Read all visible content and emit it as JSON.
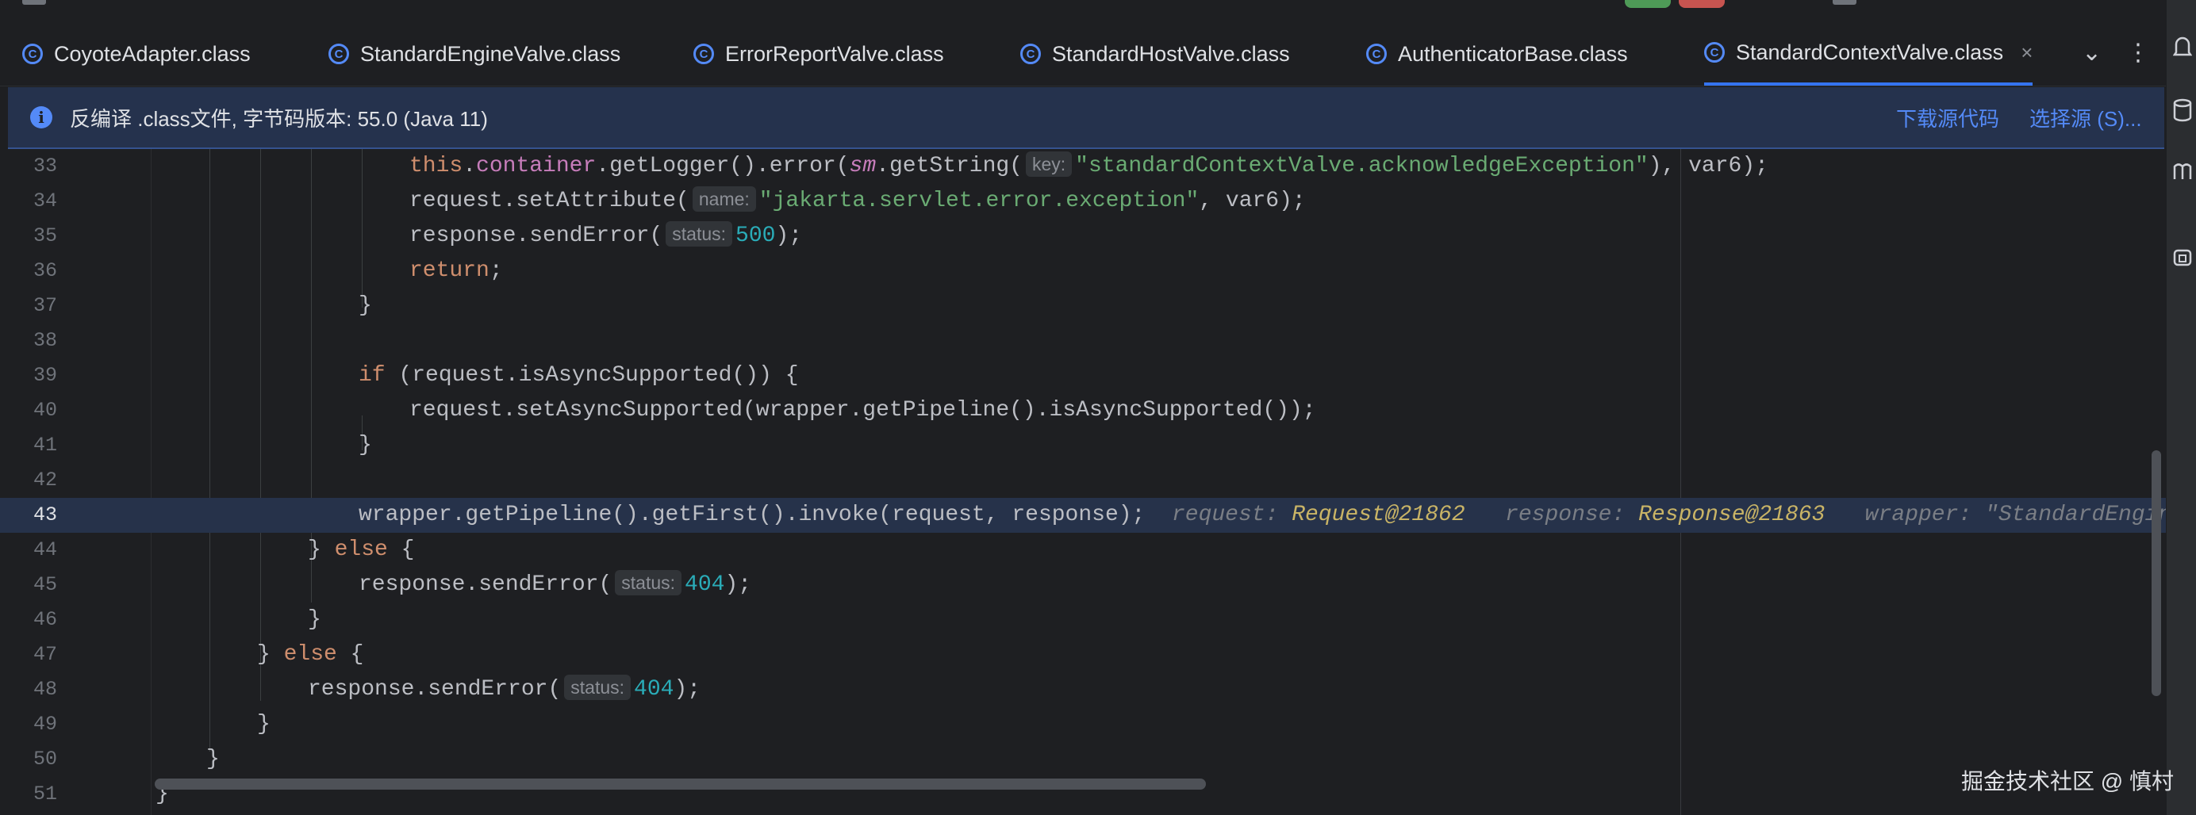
{
  "tabs": [
    {
      "label": "CoyoteAdapter.class",
      "active": false
    },
    {
      "label": "StandardEngineValve.class",
      "active": false
    },
    {
      "label": "ErrorReportValve.class",
      "active": false
    },
    {
      "label": "StandardHostValve.class",
      "active": false
    },
    {
      "label": "AuthenticatorBase.class",
      "active": false
    },
    {
      "label": "StandardContextValve.class",
      "active": true
    }
  ],
  "tab_icon_letter": "C",
  "tab_close_glyph": "×",
  "tab_actions": {
    "dropdown_glyph": "⌄",
    "more_glyph": "⋮"
  },
  "banner": {
    "icon_glyph": "i",
    "text": "反编译 .class文件, 字节码版本: 55.0 (Java 11)",
    "download_link": "下载源代码",
    "choose_link": "选择源 (S)..."
  },
  "hints": {
    "key": "key:",
    "name": "name:",
    "status": "status:"
  },
  "strings": {
    "ack_key": "\"standardContextValve.acknowledgeException\"",
    "servlet_attr": "\"jakarta.servlet.error.exception\""
  },
  "numbers": {
    "status_500": "500",
    "status_404": "404"
  },
  "debug": {
    "request_label": "request:",
    "request_value": "Request@21862",
    "response_label": "response:",
    "response_value": "Response@21863",
    "wrapper_label": "wrapper:",
    "wrapper_value": "\"StandardEngine[To"
  },
  "line_numbers": [
    "33",
    "34",
    "35",
    "36",
    "37",
    "38",
    "39",
    "40",
    "41",
    "42",
    "43",
    "44",
    "45",
    "46",
    "47",
    "48",
    "49",
    "50",
    "51"
  ],
  "current_line": "43",
  "right_strip_icons": [
    "notification-bell-icon",
    "database-icon",
    "m-icon",
    "copilot-icon"
  ],
  "watermark": "掘金技术社区 @ 慎村",
  "colors": {
    "background": "#1e1f22",
    "accent": "#3574f0",
    "keyword": "#cf8e6d",
    "string": "#6aab73",
    "number": "#2aacb8",
    "current_line_bg": "#26324a"
  }
}
